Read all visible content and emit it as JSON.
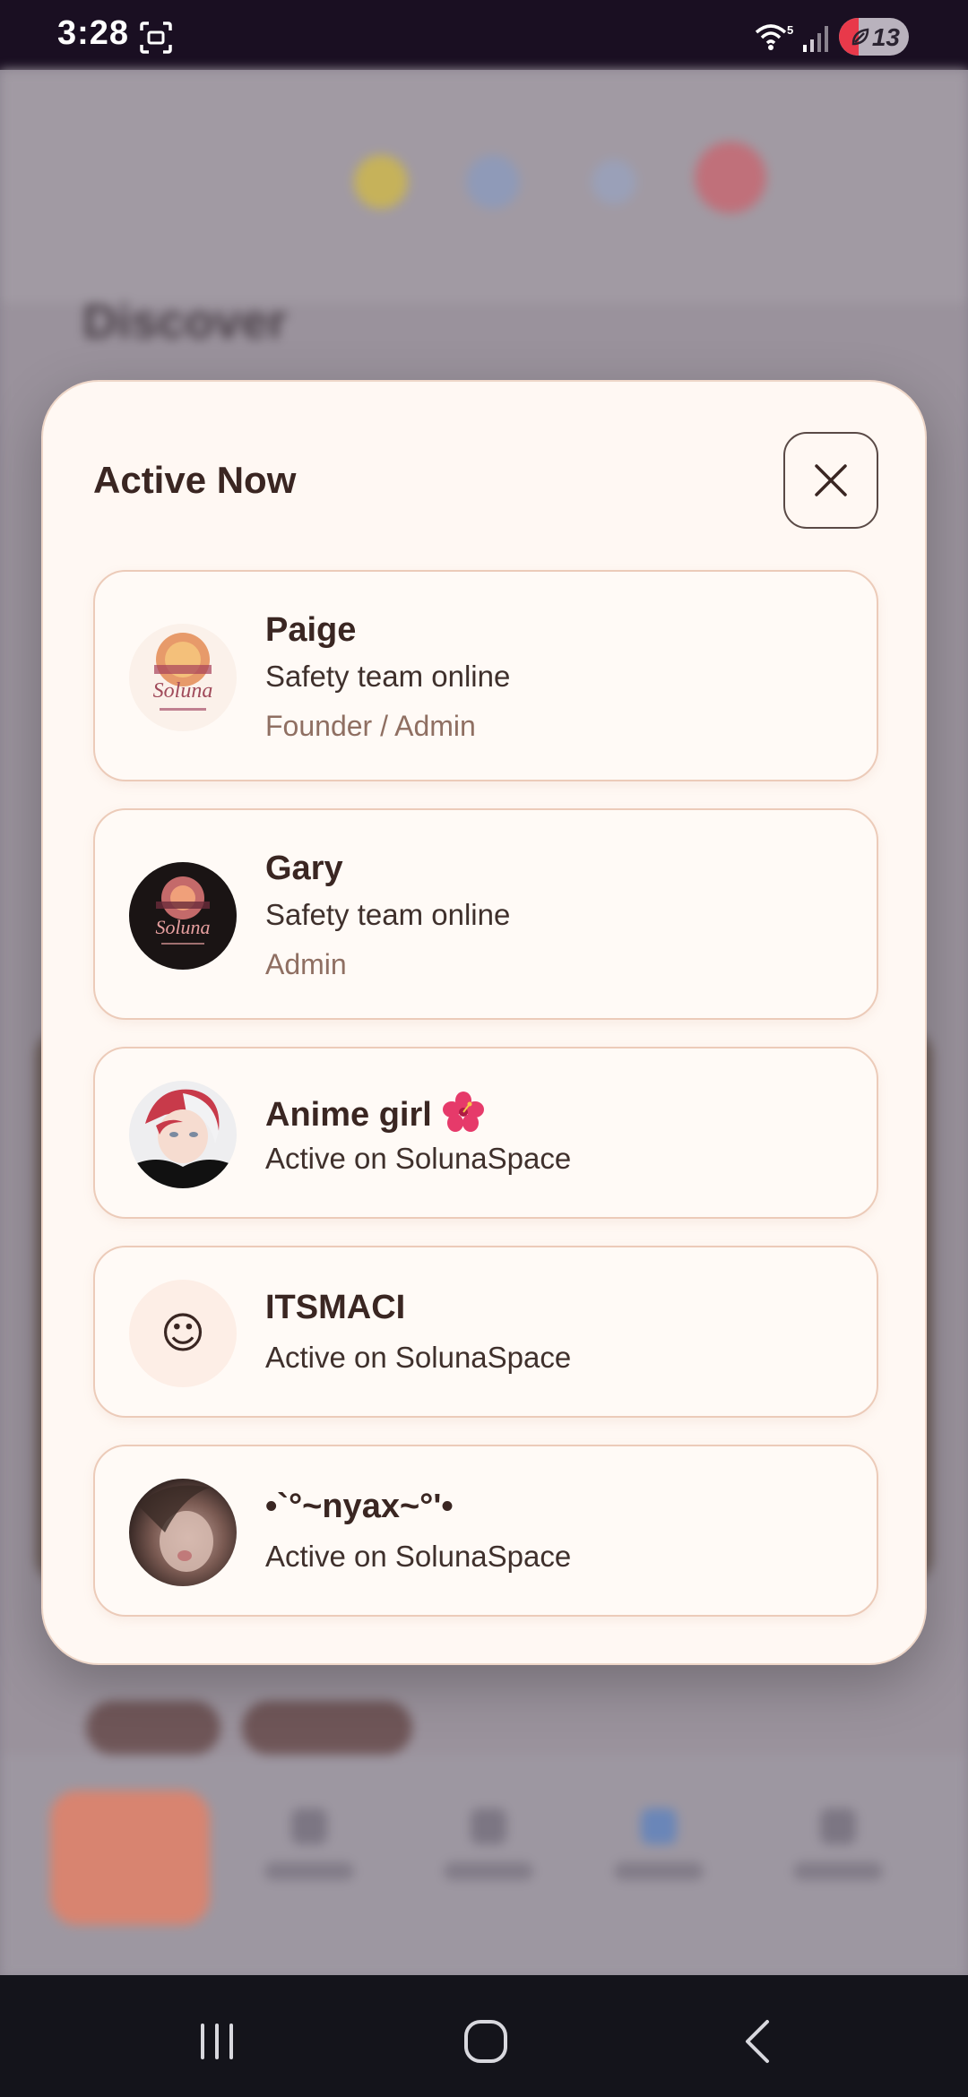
{
  "status_bar": {
    "time": "3:28",
    "battery_level": "13",
    "battery_fraction": 0.13,
    "wifi_label": "5",
    "icons": [
      "screenshot-icon",
      "wifi-icon",
      "signal-icon",
      "battery-icon"
    ]
  },
  "background": {
    "page_title": "Discover"
  },
  "modal": {
    "title": "Active Now",
    "close_icon": "close-icon",
    "users": [
      {
        "name": "Paige",
        "status": "Safety team online",
        "role": "Founder / Admin",
        "avatar": "solunaspace-logo-light"
      },
      {
        "name": "Gary",
        "status": "Safety team online",
        "role": "Admin",
        "avatar": "solunaspace-logo-dark"
      },
      {
        "name": "Anime girl",
        "name_emoji": "hibiscus-icon",
        "status": "Active on SolunaSpace",
        "avatar": "anime-avatar"
      },
      {
        "name": "ITSMACI",
        "status": "Active on SolunaSpace",
        "avatar_glyph": "☺"
      },
      {
        "name": "•`°~nyax~°'•",
        "status": "Active on SolunaSpace",
        "avatar": "photo-avatar"
      }
    ]
  },
  "colors": {
    "modal_bg": "#fff8f3",
    "card_border": "#eccbb9",
    "text_primary": "#3a2622",
    "text_role": "#8f6f62",
    "status_bar_bg": "#1a0f22",
    "nav_bg": "#14141b"
  },
  "system_nav": {
    "icons": [
      "recents-icon",
      "home-icon",
      "back-icon"
    ]
  }
}
